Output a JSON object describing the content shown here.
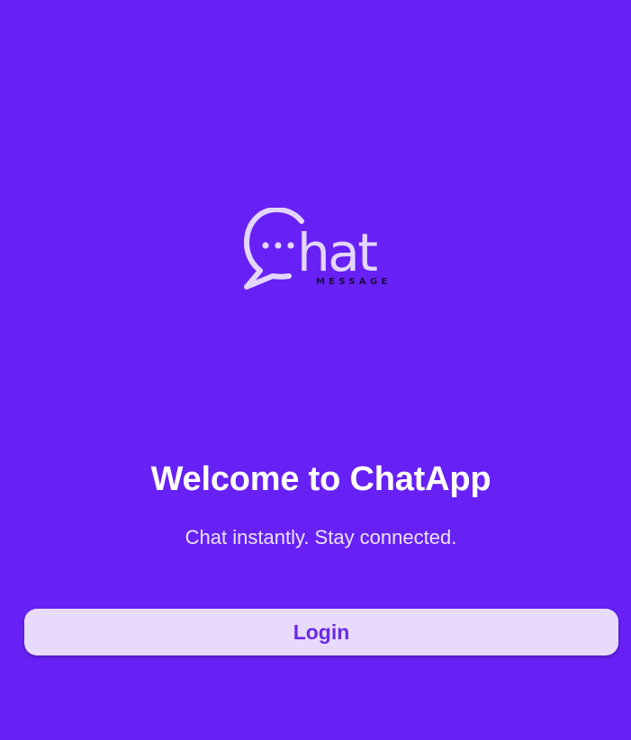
{
  "logo": {
    "icon": "chat-bubble-icon",
    "word": "hat",
    "tagline": "MESSAGE"
  },
  "welcome": {
    "title": "Welcome to ChatApp",
    "subtitle": "Chat instantly. Stay connected."
  },
  "actions": {
    "login_label": "Login"
  },
  "colors": {
    "background": "#6721F5",
    "button_bg": "#E7DAFB",
    "button_text": "#6A2AE6",
    "logo": "#E4D6FF"
  }
}
